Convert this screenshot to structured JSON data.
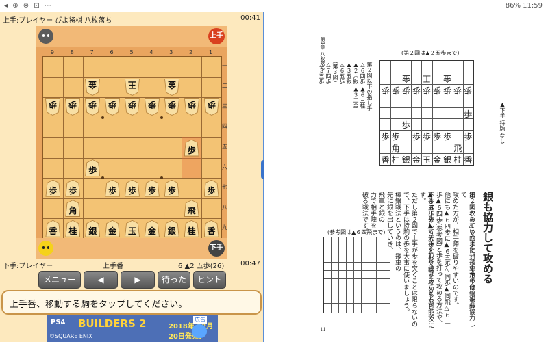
{
  "status_bar": {
    "left_icons": "◂ ⊕ ⊗ ⊡ ⋯",
    "right": "86% 11:59"
  },
  "game": {
    "top_info": "上手:プレイヤー  ぴよ将棋 八枚落ち",
    "top_clock": "00:41",
    "top_role": "上手",
    "bottom_role": "下手",
    "bottom_info": "下手:プレイヤー",
    "turn_label": "上手番",
    "last_move": "6 ▲2 五歩(26)",
    "bottom_clock": "00:47",
    "files": [
      "9",
      "8",
      "7",
      "6",
      "5",
      "4",
      "3",
      "2",
      "1"
    ],
    "ranks": [
      "一",
      "二",
      "三",
      "四",
      "五",
      "六",
      "七",
      "八",
      "九"
    ],
    "pieces": [
      {
        "f": 7,
        "r": 2,
        "ch": "金",
        "side": "gote"
      },
      {
        "f": 5,
        "r": 2,
        "ch": "王",
        "side": "gote"
      },
      {
        "f": 3,
        "r": 2,
        "ch": "金",
        "side": "gote"
      },
      {
        "f": 9,
        "r": 3,
        "ch": "歩",
        "side": "gote"
      },
      {
        "f": 8,
        "r": 3,
        "ch": "歩",
        "side": "gote"
      },
      {
        "f": 7,
        "r": 3,
        "ch": "歩",
        "side": "gote"
      },
      {
        "f": 6,
        "r": 3,
        "ch": "歩",
        "side": "gote"
      },
      {
        "f": 5,
        "r": 3,
        "ch": "歩",
        "side": "gote"
      },
      {
        "f": 4,
        "r": 3,
        "ch": "歩",
        "side": "gote"
      },
      {
        "f": 3,
        "r": 3,
        "ch": "歩",
        "side": "gote"
      },
      {
        "f": 2,
        "r": 3,
        "ch": "歩",
        "side": "gote"
      },
      {
        "f": 1,
        "r": 3,
        "ch": "歩",
        "side": "gote"
      },
      {
        "f": 2,
        "r": 5,
        "ch": "歩",
        "side": "sente"
      },
      {
        "f": 7,
        "r": 6,
        "ch": "歩",
        "side": "sente"
      },
      {
        "f": 9,
        "r": 7,
        "ch": "歩",
        "side": "sente"
      },
      {
        "f": 8,
        "r": 7,
        "ch": "歩",
        "side": "sente"
      },
      {
        "f": 6,
        "r": 7,
        "ch": "歩",
        "side": "sente"
      },
      {
        "f": 5,
        "r": 7,
        "ch": "歩",
        "side": "sente"
      },
      {
        "f": 4,
        "r": 7,
        "ch": "歩",
        "side": "sente"
      },
      {
        "f": 3,
        "r": 7,
        "ch": "歩",
        "side": "sente"
      },
      {
        "f": 1,
        "r": 7,
        "ch": "歩",
        "side": "sente"
      },
      {
        "f": 8,
        "r": 8,
        "ch": "角",
        "side": "sente"
      },
      {
        "f": 2,
        "r": 8,
        "ch": "飛",
        "side": "sente"
      },
      {
        "f": 9,
        "r": 9,
        "ch": "香",
        "side": "sente"
      },
      {
        "f": 8,
        "r": 9,
        "ch": "桂",
        "side": "sente"
      },
      {
        "f": 7,
        "r": 9,
        "ch": "銀",
        "side": "sente"
      },
      {
        "f": 6,
        "r": 9,
        "ch": "金",
        "side": "sente"
      },
      {
        "f": 5,
        "r": 9,
        "ch": "玉",
        "side": "sente"
      },
      {
        "f": 4,
        "r": 9,
        "ch": "金",
        "side": "sente"
      },
      {
        "f": 3,
        "r": 9,
        "ch": "銀",
        "side": "sente"
      },
      {
        "f": 2,
        "r": 9,
        "ch": "桂",
        "side": "sente"
      },
      {
        "f": 1,
        "r": 9,
        "ch": "香",
        "side": "sente"
      }
    ],
    "highlight": [
      {
        "f": 2,
        "r": 5
      },
      {
        "f": 2,
        "r": 6
      }
    ],
    "buttons": {
      "menu": "メニュー",
      "back": "◀",
      "forward": "▶",
      "undo": "待った",
      "hint": "ヒント"
    },
    "message": "上手番、移動する駒をタップしてください。",
    "ad": {
      "platform": "PS4",
      "title": "BUILDERS 2",
      "date": "2018年 12月20日発売!",
      "tag": "広告",
      "publisher": "©SQUARE ENIX"
    }
  },
  "book": {
    "chapter_head": "第1章  八枚落ち",
    "fig2_title": "(第２図は▲２五歩まで)",
    "ref_title": "(参考図は▲６四飛まで)",
    "right_note": "▲下手  持駒  なし",
    "moves_col": [
      "第２図以下の指し手",
      "△６四歩  ▲６三桂",
      "▲２六銀  ▲３二金",
      "▲３五銀",
      "△６五歩",
      "(第３図)",
      "△７四歩",
      "△３五歩"
    ],
    "heading": "銀も協力して攻める",
    "para": [
      "第２図から△６四歩に対して下手は銀を繰り",
      "出して攻めていきます。飛車角の他、銀も協力して",
      "攻めた方が、相手陣を破りやすいのです。",
      "他にも▲６四歩に▲６五歩△同歩▲同飛△６三",
      "歩▲６四歩(参考図)と歩を打って攻める方法や、",
      "▲８五歩や▲９五歩として端を攻めるなど、次に",
      "下手は工夫して先手を取り続けることも可能です。",
      "ただし第２図で上手が歩を突くことは限らないの",
      "で、下手は持駒の歩を大事に使いましょう。",
      "棒銀戦法というのは、飛車の",
      "先に銀を出していき、",
      "飛車と銀の",
      "力で相手陣を",
      "破る戦法です。"
    ],
    "fig2_left": "▲下手 持駒 なし",
    "fig2_pieces": [
      {
        "f": 7,
        "r": 2,
        "ch": "金",
        "g": true
      },
      {
        "f": 5,
        "r": 2,
        "ch": "王",
        "g": true
      },
      {
        "f": 3,
        "r": 2,
        "ch": "金",
        "g": true
      },
      {
        "f": 9,
        "r": 3,
        "ch": "歩",
        "g": true
      },
      {
        "f": 8,
        "r": 3,
        "ch": "歩",
        "g": true
      },
      {
        "f": 7,
        "r": 3,
        "ch": "歩",
        "g": true
      },
      {
        "f": 6,
        "r": 3,
        "ch": "歩",
        "g": true
      },
      {
        "f": 5,
        "r": 3,
        "ch": "歩",
        "g": true
      },
      {
        "f": 4,
        "r": 3,
        "ch": "歩",
        "g": true
      },
      {
        "f": 3,
        "r": 3,
        "ch": "歩",
        "g": true
      },
      {
        "f": 2,
        "r": 3,
        "ch": "歩",
        "g": true
      },
      {
        "f": 1,
        "r": 3,
        "ch": "歩",
        "g": true
      },
      {
        "f": 1,
        "r": 5,
        "ch": "歩",
        "g": false
      },
      {
        "f": 7,
        "r": 6,
        "ch": "歩",
        "g": false
      },
      {
        "f": 9,
        "r": 7,
        "ch": "歩",
        "g": false
      },
      {
        "f": 8,
        "r": 7,
        "ch": "歩",
        "g": false
      },
      {
        "f": 6,
        "r": 7,
        "ch": "歩",
        "g": false
      },
      {
        "f": 5,
        "r": 7,
        "ch": "歩",
        "g": false
      },
      {
        "f": 4,
        "r": 7,
        "ch": "歩",
        "g": false
      },
      {
        "f": 3,
        "r": 7,
        "ch": "歩",
        "g": false
      },
      {
        "f": 1,
        "r": 7,
        "ch": "歩",
        "g": false
      },
      {
        "f": 8,
        "r": 8,
        "ch": "角",
        "g": false
      },
      {
        "f": 2,
        "r": 8,
        "ch": "飛",
        "g": false
      },
      {
        "f": 9,
        "r": 9,
        "ch": "香",
        "g": false
      },
      {
        "f": 8,
        "r": 9,
        "ch": "桂",
        "g": false
      },
      {
        "f": 7,
        "r": 9,
        "ch": "銀",
        "g": false
      },
      {
        "f": 6,
        "r": 9,
        "ch": "金",
        "g": false
      },
      {
        "f": 5,
        "r": 9,
        "ch": "玉",
        "g": false
      },
      {
        "f": 4,
        "r": 9,
        "ch": "金",
        "g": false
      },
      {
        "f": 3,
        "r": 9,
        "ch": "銀",
        "g": false
      },
      {
        "f": 2,
        "r": 9,
        "ch": "桂",
        "g": false
      },
      {
        "f": 1,
        "r": 9,
        "ch": "香",
        "g": false
      }
    ],
    "page_number": "11"
  }
}
